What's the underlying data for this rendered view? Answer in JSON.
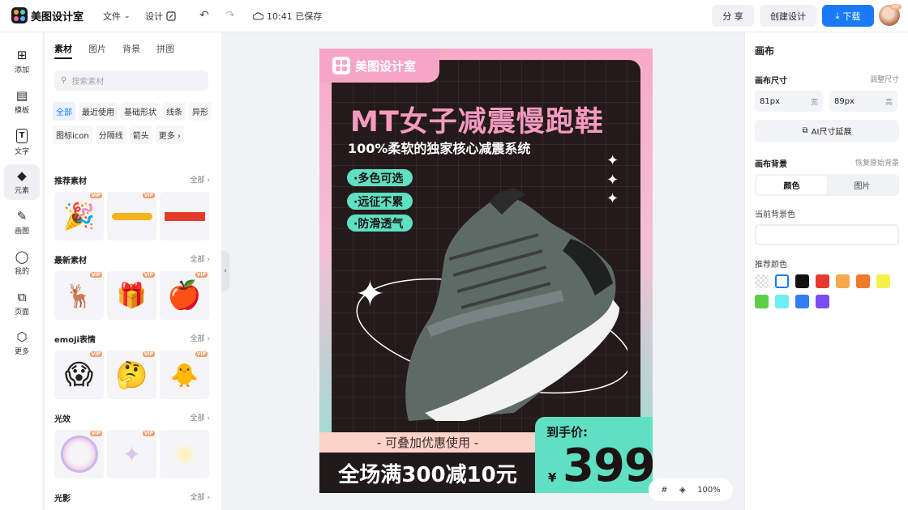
{
  "topbar": {
    "app_title": "美图设计室",
    "file_menu": "文件",
    "design_menu": "设计",
    "save_status": "10:41 已保存",
    "share_label": "分 享",
    "create_label": "创建设计",
    "download_label": "下载",
    "avatar_badge": "VIP"
  },
  "leftnav": [
    {
      "label": "添加",
      "icon": "plus-square-icon"
    },
    {
      "label": "模板",
      "icon": "template-icon"
    },
    {
      "label": "文字",
      "icon": "text-icon"
    },
    {
      "label": "元素",
      "icon": "shapes-icon"
    },
    {
      "label": "画图",
      "icon": "pen-icon"
    },
    {
      "label": "我的",
      "icon": "user-icon"
    },
    {
      "label": "页面",
      "icon": "add-page-icon"
    },
    {
      "label": "更多",
      "icon": "cube-icon"
    }
  ],
  "panel": {
    "tabs": [
      "素材",
      "图片",
      "背景",
      "拼图"
    ],
    "search_placeholder": "搜索素材",
    "chips": [
      "全部",
      "最近使用",
      "基础形状",
      "线条",
      "异形",
      "图标icon",
      "分隔线",
      "箭头",
      "更多 ›"
    ],
    "all_label": "全部",
    "vip": "VIP",
    "sections": [
      {
        "title": "推荐素材"
      },
      {
        "title": "最新素材"
      },
      {
        "title": "emoji表情"
      },
      {
        "title": "光效"
      },
      {
        "title": "光影"
      }
    ]
  },
  "poster": {
    "brand": "美图设计室",
    "headline": "MT女子减震慢跑鞋",
    "subline": "100%柔软的独家核心减震系统",
    "features": [
      "·多色可选",
      "·远征不累",
      "·防滑透气"
    ],
    "coupon": "- 可叠加优惠使用 -",
    "promo": "全场满300减10元",
    "price_label": "到手价:",
    "currency": "¥",
    "price": "399",
    "colors": {
      "pink": "#f8a9c8",
      "mint": "#5fe0c2",
      "dark": "#241a1a"
    }
  },
  "zoom": {
    "level": "100%"
  },
  "rightpanel": {
    "title": "画布",
    "size_label": "画布尺寸",
    "size_adjust": "调整尺寸",
    "width_value": "81px",
    "width_unit": "宽",
    "height_value": "89px",
    "height_unit": "高",
    "ai_button": "AI尺寸延展",
    "bg_label": "画布背景",
    "bg_reset": "恢复原始背景",
    "bg_tabs": [
      "颜色",
      "图片"
    ],
    "current_bg_label": "当前背景色",
    "recommended_label": "推荐颜色",
    "swatches": [
      "transparent",
      "#ffffff",
      "#111111",
      "#e8392e",
      "#f5a94a",
      "#f07a2a",
      "#f7f04a",
      "#5ccf46",
      "#6ff0f0",
      "#2f7ff2",
      "#7b4cf0"
    ]
  }
}
